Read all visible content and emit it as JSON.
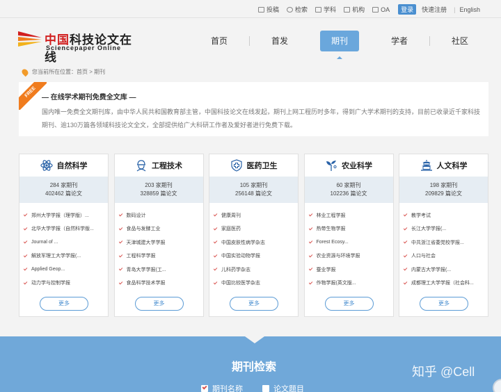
{
  "top_links": [
    {
      "label": "投稿",
      "icon": "submit-icon"
    },
    {
      "label": "检索",
      "icon": "search-icon"
    },
    {
      "label": "学科",
      "icon": "subject-icon"
    },
    {
      "label": "机构",
      "icon": "institution-icon"
    },
    {
      "label": "OA",
      "icon": "oa-icon"
    }
  ],
  "auth": {
    "login": "登录",
    "register": "快速注册",
    "language": "English"
  },
  "logo": {
    "cn_red": "中国",
    "cn_black": "科技论文在线",
    "en": "Sciencepaper Online"
  },
  "nav": [
    "首页",
    "首发",
    "期刊",
    "学者",
    "社区"
  ],
  "breadcrumb": "您当前所在位置：首页 > 期刊",
  "intro": {
    "badge": "FREE",
    "title": "— 在线学术期刊免费全文库 —",
    "desc": "国内唯一免费全文期刊库，由中华人民共和国教育部主管，中国科技论文在线发起，期刊上网工程历时多年，得到广大学术期刊的支持，目前已收录近千家科技期刊、逾130万篇各领域科技论文全文，全部提供给广大科研工作者及爱好者进行免费下载。"
  },
  "categories": [
    {
      "name": "自然科学",
      "icon": "atom-icon",
      "journals": "284 家期刊",
      "papers": "402462 篇论文",
      "items": [
        "郑州大学学报（理学版）...",
        "北华大学学报（自然科学版...",
        "Journal of ...",
        "解放军理工大学学报(...",
        "Applied Geop...",
        "动力学与控制学报"
      ]
    },
    {
      "name": "工程技术",
      "icon": "engineer-icon",
      "journals": "203 家期刊",
      "papers": "328859 篇论文",
      "items": [
        "数码设计",
        "食品与发酵工业",
        "天津城建大学学报",
        "工程科学学报",
        "青岛大学学报(工...",
        "食品科学技术学报"
      ]
    },
    {
      "name": "医药卫生",
      "icon": "medical-shield-icon",
      "journals": "105 家期刊",
      "papers": "256148 篇论文",
      "items": [
        "健康周刊",
        "家庭医药",
        "中国皮肤性病学杂志",
        "中国实验动物学报",
        "儿科药学杂志",
        "中国比较医学杂志"
      ]
    },
    {
      "name": "农业科学",
      "icon": "sprout-icon",
      "journals": "60 家期刊",
      "papers": "102236 篇论文",
      "items": [
        "林业工程学报",
        "热带生物学报",
        "Forest Ecosy...",
        "农业资源与环境学报",
        "蚕业学报",
        "作物学报(英文版..."
      ]
    },
    {
      "name": "人文科学",
      "icon": "pagoda-icon",
      "journals": "198 家期刊",
      "papers": "209829 篇论文",
      "items": [
        "教学考试",
        "长江大学学报(...",
        "中共浙江省委党校学报...",
        "人口与社会",
        "内蒙古大学学报(...",
        "成都理工大学学报（社会科..."
      ]
    }
  ],
  "more_label": "更多",
  "search": {
    "title": "期刊检索",
    "options": [
      {
        "label": "期刊名称",
        "checked": true
      },
      {
        "label": "论文题目",
        "checked": false
      }
    ]
  },
  "watermark": "知乎 @Cell",
  "colors": {
    "nav_active": "#6aa7dc",
    "search_bg": "#70a8d9",
    "brand_red": "#d11e1e",
    "badge_orange": "#f07c1e"
  }
}
